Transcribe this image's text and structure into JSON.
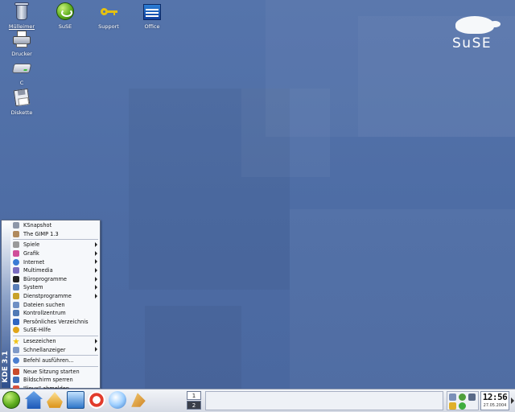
{
  "desktop": {
    "icons": [
      {
        "label": "Mülleimer",
        "icon": "trash-icon"
      },
      {
        "label": "SuSE",
        "icon": "suse-icon"
      },
      {
        "label": "Support",
        "icon": "key-icon"
      },
      {
        "label": "Office",
        "icon": "office-icon"
      },
      {
        "label": "Drucker",
        "icon": "printer-icon"
      },
      {
        "label": "C",
        "icon": "harddisk-icon"
      },
      {
        "label": "Diskette",
        "icon": "floppy-icon"
      }
    ],
    "logo_text": "SuSE"
  },
  "kmenu": {
    "side_label": "KDE 3.1",
    "items": [
      {
        "label": "KSnapshot",
        "icon": "camera-icon",
        "color": "#8d96a8"
      },
      {
        "label": "The GIMP 1.3",
        "icon": "gimp-icon",
        "color": "#b08a5e"
      },
      {
        "label": "Spiele",
        "icon": "games-icon",
        "color": "#9a9a9a"
      },
      {
        "label": "Grafik",
        "icon": "graphics-icon",
        "color": "#d04f9a"
      },
      {
        "label": "Internet",
        "icon": "globe-icon",
        "color": "#3a7bd5"
      },
      {
        "label": "Multimedia",
        "icon": "multimedia-icon",
        "color": "#7a6cc0"
      },
      {
        "label": "Büroprogramme",
        "icon": "office-suite-icon",
        "color": "#222222"
      },
      {
        "label": "System",
        "icon": "monitor-icon",
        "color": "#5a7fb8"
      },
      {
        "label": "Dienstprogramme",
        "icon": "utilities-icon",
        "color": "#c8a22a"
      },
      {
        "label": "Dateien suchen",
        "icon": "find-files-icon",
        "color": "#6e8fc4"
      },
      {
        "label": "Kontrollzentrum",
        "icon": "control-center-icon",
        "color": "#4f79b5"
      },
      {
        "label": "Persönliches Verzeichnis",
        "icon": "home-folder-icon",
        "color": "#2f66c2"
      },
      {
        "label": "SuSE-Hilfe",
        "icon": "help-icon",
        "color": "#e0a51a"
      },
      {
        "label": "Lesezeichen",
        "icon": "bookmark-star-icon",
        "color": "#f0c419"
      },
      {
        "label": "Schnellanzeiger",
        "icon": "quick-browser-icon",
        "color": "#7f9ac8"
      },
      {
        "label": "Befehl ausführen...",
        "icon": "run-command-icon",
        "color": "#4a7ed0"
      },
      {
        "label": "Neue Sitzung starten",
        "icon": "new-session-icon",
        "color": "#c94a2a"
      },
      {
        "label": "Bildschirm sperren",
        "icon": "lock-icon",
        "color": "#3f6fb8"
      },
      {
        "label": "\"linux\" abmelden...",
        "icon": "logout-icon",
        "color": "#d8503a"
      }
    ]
  },
  "taskbar": {
    "pager": [
      "1",
      "2"
    ],
    "clock_time": "12:56",
    "clock_date": "27.05.2004"
  }
}
